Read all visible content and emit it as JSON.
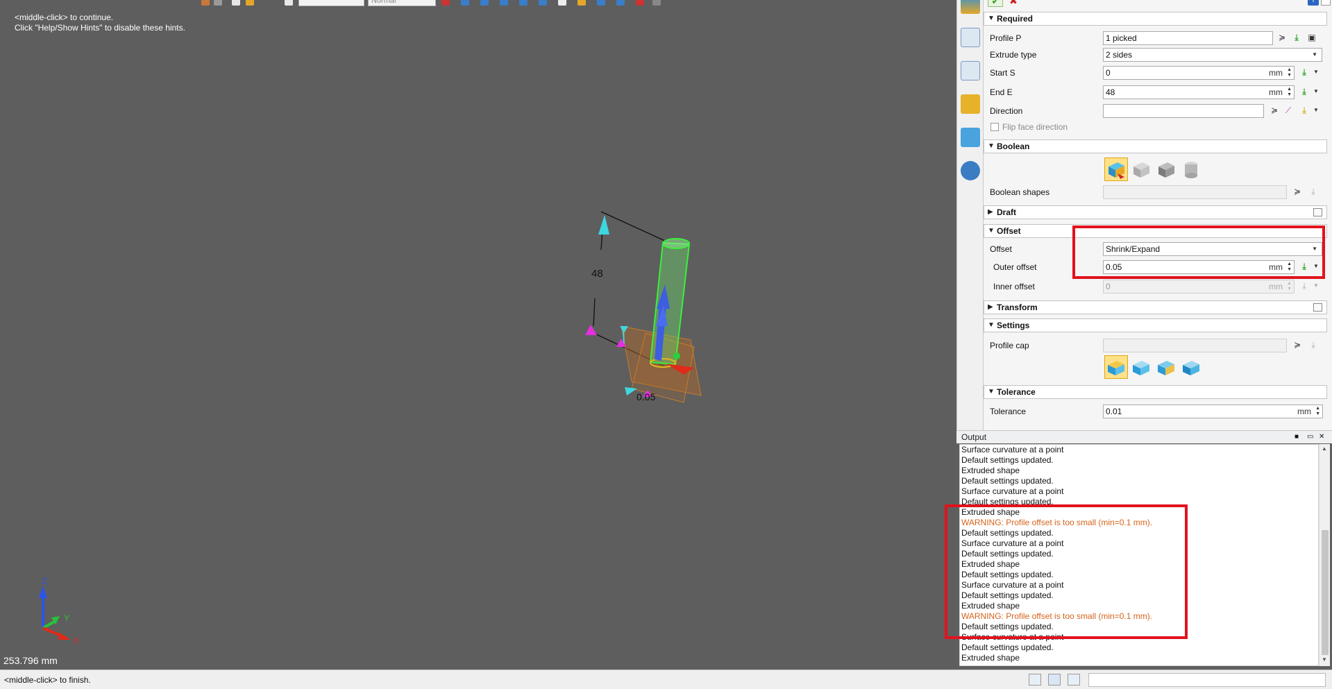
{
  "viewport": {
    "hints": [
      "<middle-click> to continue.",
      "Click \"Help/Show Hints\" to disable these hints."
    ],
    "scale_readout": "253.796 mm",
    "dimension_height": "48",
    "dimension_offset": "0.05",
    "toolbar_style_value": "Normal",
    "triad": {
      "z": "Z",
      "y": "Y",
      "x": "X"
    }
  },
  "statusbar": {
    "message": "<middle-click> to finish."
  },
  "panel": {
    "ok_icon": "check-icon",
    "cancel_icon": "x-icon",
    "required": {
      "title": "Required",
      "profile_label": "Profile P",
      "profile_value": "1 picked",
      "extrude_type_label": "Extrude type",
      "extrude_type_value": "2 sides",
      "start_label": "Start S",
      "start_value": "0",
      "start_unit": "mm",
      "end_label": "End E",
      "end_value": "48",
      "end_unit": "mm",
      "direction_label": "Direction",
      "direction_value": "",
      "flip_label": "Flip face direction"
    },
    "boolean": {
      "title": "Boolean",
      "shapes_label": "Boolean shapes",
      "shapes_value": ""
    },
    "draft": {
      "title": "Draft"
    },
    "offset": {
      "title": "Offset",
      "offset_label": "Offset",
      "offset_value": "Shrink/Expand",
      "outer_label": "Outer offset",
      "outer_value": "0.05",
      "outer_unit": "mm",
      "inner_label": "Inner offset",
      "inner_value": "0",
      "inner_unit": "mm"
    },
    "transform": {
      "title": "Transform"
    },
    "settings": {
      "title": "Settings",
      "profile_cap_label": "Profile cap",
      "profile_cap_value": ""
    },
    "tolerance": {
      "title": "Tolerance",
      "label": "Tolerance",
      "value": "0.01",
      "unit": "mm"
    }
  },
  "output": {
    "title": "Output",
    "lines": [
      {
        "text": "Surface curvature at a point",
        "warn": false
      },
      {
        "text": "Default settings updated.",
        "warn": false
      },
      {
        "text": "Extruded shape",
        "warn": false
      },
      {
        "text": "Default settings updated.",
        "warn": false
      },
      {
        "text": "Surface curvature at a point",
        "warn": false
      },
      {
        "text": "Default settings updated.",
        "warn": false
      },
      {
        "text": "Extruded shape",
        "warn": false
      },
      {
        "text": "WARNING: Profile offset is too small (min=0.1 mm).",
        "warn": true
      },
      {
        "text": "Default settings updated.",
        "warn": false
      },
      {
        "text": "Surface curvature at a point",
        "warn": false
      },
      {
        "text": "Default settings updated.",
        "warn": false
      },
      {
        "text": "Extruded shape",
        "warn": false
      },
      {
        "text": "Default settings updated.",
        "warn": false
      },
      {
        "text": "Surface curvature at a point",
        "warn": false
      },
      {
        "text": "Default settings updated.",
        "warn": false
      },
      {
        "text": "Extruded shape",
        "warn": false
      },
      {
        "text": "WARNING: Profile offset is too small (min=0.1 mm).",
        "warn": true
      },
      {
        "text": "Default settings updated.",
        "warn": false
      },
      {
        "text": "Surface curvature at a point",
        "warn": false
      },
      {
        "text": "Default settings updated.",
        "warn": false
      },
      {
        "text": "Extruded shape",
        "warn": false
      }
    ]
  },
  "colors": {
    "accent_red": "#e1121d",
    "warning": "#d6621a",
    "viewport_bg": "#5e5e5e"
  }
}
